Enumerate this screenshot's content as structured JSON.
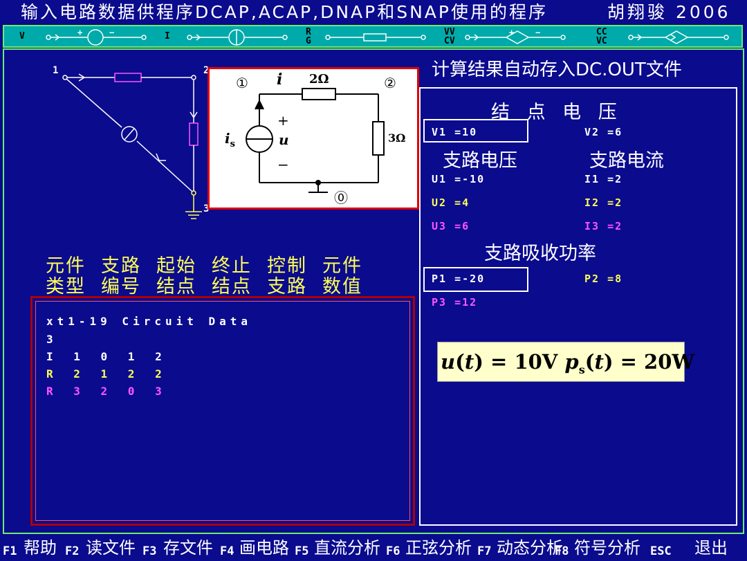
{
  "title": {
    "text": "输入电路数据供程序DCAP,ACAP,DNAP和SNAP使用的程序",
    "author": "胡翔骏 2006"
  },
  "palette": {
    "items": [
      {
        "label": "V",
        "icon": "voltage-source-icon"
      },
      {
        "label": "I",
        "icon": "current-source-icon"
      },
      {
        "label": "R\nG",
        "icon": "resistor-icon"
      },
      {
        "label": "VV\nCV",
        "icon": "vcvs-icon"
      },
      {
        "label": "CC\nVC",
        "icon": "cccs-icon"
      }
    ]
  },
  "schematic": {
    "nodes": [
      "1",
      "2",
      "3"
    ]
  },
  "diagram": {
    "node1": "①",
    "node2": "②",
    "node0": "⓪",
    "current": "i",
    "r1": "2Ω",
    "r2": "3Ω",
    "source": "i",
    "source_sub": "s",
    "voltage": "u",
    "plus": "+",
    "minus": "−"
  },
  "results": {
    "save_note": "计算结果自动存入DC.OUT文件",
    "node_voltage_title": "结 点 电 压",
    "v1": "V1 =10",
    "v2": "V2 =6",
    "branch_voltage_title": "支路电压",
    "branch_current_title": "支路电流",
    "u1": "U1 =-10",
    "i1": "I1 =2",
    "u2": "U2 =4",
    "i2": "I2 =2",
    "u3": "U3 =6",
    "i3": "I3 =2",
    "power_title": "支路吸收功率",
    "p1": "P1 =-20",
    "p2": "P2 =8",
    "p3": "P3 =12"
  },
  "formula": {
    "u": "u",
    "t1": "t",
    "eq1": ") = 10V  ",
    "p": "p",
    "sub": "s",
    "t2": "t",
    "eq2": ") = 20W"
  },
  "table_header": {
    "row1": [
      "元件",
      "支路",
      "起始",
      "终止",
      "控制",
      "元件"
    ],
    "row2": [
      "类型",
      "编号",
      "结点",
      "结点",
      "支路",
      "数值"
    ]
  },
  "editor": {
    "lines": [
      {
        "text": "xt1-19   Circuit Data",
        "color": "#ffffff"
      },
      {
        "text": "3",
        "color": "#ffffff"
      },
      {
        "text": "I 1 0 1 2",
        "color": "#ffffff"
      },
      {
        "text": "R 2 1 2 2",
        "color": "#ffff55"
      },
      {
        "text": "R 3 2 0 3",
        "color": "#ff55ff"
      }
    ]
  },
  "function_keys": [
    {
      "key": "F1",
      "label": "帮助"
    },
    {
      "key": "F2",
      "label": "读文件"
    },
    {
      "key": "F3",
      "label": "存文件"
    },
    {
      "key": "F4",
      "label": "画电路"
    },
    {
      "key": "F5",
      "label": "直流分析"
    },
    {
      "key": "F6",
      "label": "正弦分析"
    },
    {
      "key": "F7",
      "label": "动态分析"
    },
    {
      "key": "F8",
      "label": "符号分析"
    },
    {
      "key": "ESC",
      "label": "退出"
    }
  ],
  "colors": {
    "background": "#0b0b8e",
    "palette_bg": "#00aaaa",
    "frame_green": "#6af06a",
    "accent_yellow": "#ffff55",
    "accent_magenta": "#ff55ff",
    "diagram_border": "#e00000"
  }
}
